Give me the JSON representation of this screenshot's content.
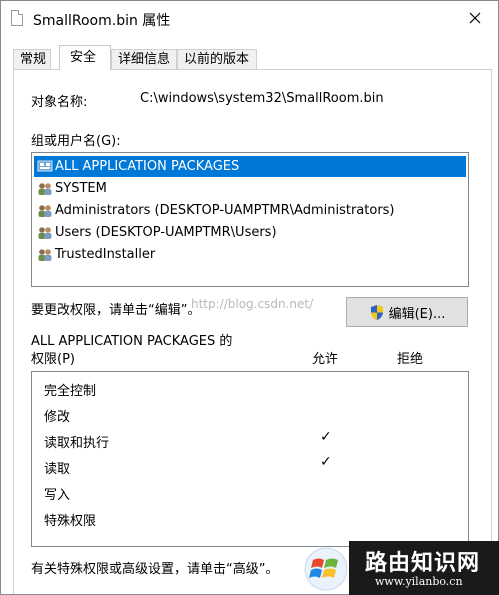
{
  "window": {
    "title": "SmallRoom.bin 属性"
  },
  "tabs": [
    {
      "label": "常规"
    },
    {
      "label": "安全"
    },
    {
      "label": "详细信息"
    },
    {
      "label": "以前的版本"
    }
  ],
  "object": {
    "label": "对象名称:",
    "value": "C:\\windows\\system32\\SmallRoom.bin"
  },
  "users": {
    "label": "组或用户名(G):",
    "items": [
      {
        "label": "ALL APPLICATION PACKAGES",
        "icon": "app-packages-icon"
      },
      {
        "label": "SYSTEM",
        "icon": "user-group-icon"
      },
      {
        "label": "Administrators (DESKTOP-UAMPTMR\\Administrators)",
        "icon": "user-group-icon"
      },
      {
        "label": "Users (DESKTOP-UAMPTMR\\Users)",
        "icon": "user-group-icon"
      },
      {
        "label": "TrustedInstaller",
        "icon": "user-group-icon"
      }
    ]
  },
  "edit": {
    "hint": "要更改权限，请单击“编辑”。",
    "button_label": "编辑(E)..."
  },
  "watermark": "http://blog.csdn.net/",
  "permissions": {
    "title_line1": "ALL APPLICATION PACKAGES 的",
    "title_line2": "权限(P)",
    "col_allow": "允许",
    "col_deny": "拒绝",
    "rows": [
      {
        "name": "完全控制",
        "allow": ""
      },
      {
        "name": "修改",
        "allow": ""
      },
      {
        "name": "读取和执行",
        "allow": "✓"
      },
      {
        "name": "读取",
        "allow": "✓"
      },
      {
        "name": "写入",
        "allow": ""
      },
      {
        "name": "特殊权限",
        "allow": ""
      }
    ]
  },
  "advanced_hint": "有关特殊权限或高级设置，请单击“高级”。",
  "brand": {
    "name": "路由知识网",
    "url": "www.yilanbo.cn"
  },
  "colors": {
    "selection": "#0078d7",
    "border": "#828790",
    "button_face": "#e1e1e1"
  }
}
